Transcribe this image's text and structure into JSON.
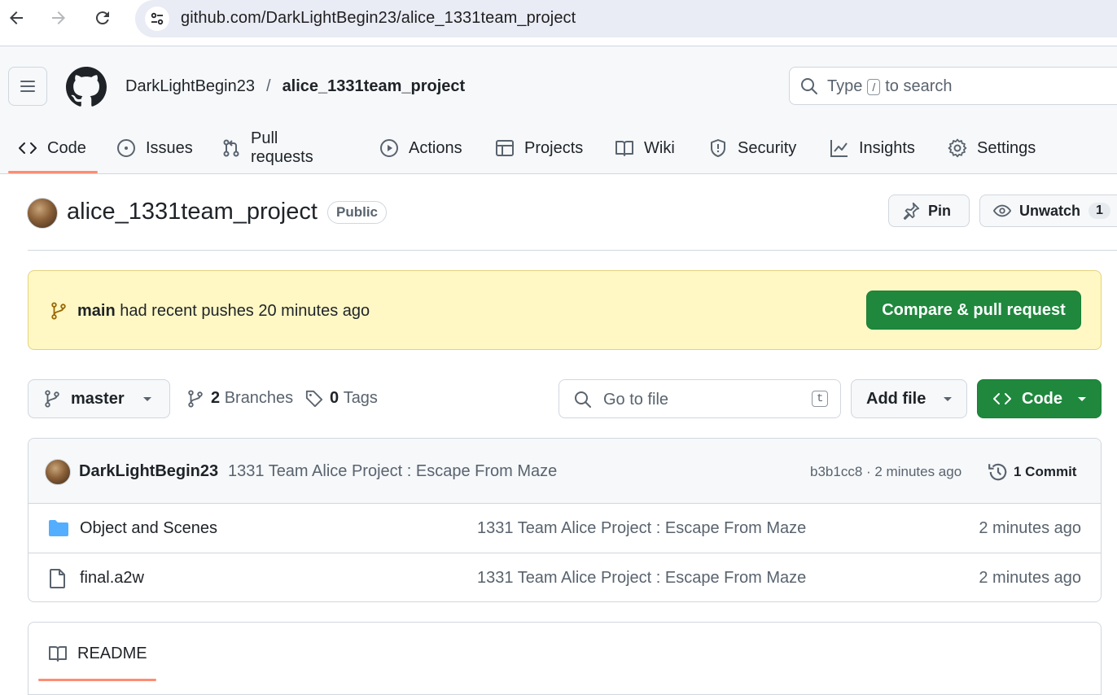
{
  "browser": {
    "url": "github.com/DarkLightBegin23/alice_1331team_project",
    "back_icon": "arrow-left-icon",
    "forward_icon": "arrow-right-icon",
    "reload_icon": "reload-icon",
    "site_info_icon": "tune-icon"
  },
  "header": {
    "owner": "DarkLightBegin23",
    "separator": "/",
    "repo": "alice_1331team_project",
    "search_prefix": "Type",
    "search_key": "/",
    "search_suffix": "to search"
  },
  "tabs": [
    {
      "label": "Code",
      "icon": "code-icon",
      "active": true
    },
    {
      "label": "Issues",
      "icon": "issue-icon"
    },
    {
      "label": "Pull requests",
      "icon": "pull-request-icon"
    },
    {
      "label": "Actions",
      "icon": "play-icon"
    },
    {
      "label": "Projects",
      "icon": "table-icon"
    },
    {
      "label": "Wiki",
      "icon": "book-icon"
    },
    {
      "label": "Security",
      "icon": "shield-icon"
    },
    {
      "label": "Insights",
      "icon": "graph-icon"
    },
    {
      "label": "Settings",
      "icon": "gear-icon"
    }
  ],
  "repo_title": {
    "name": "alice_1331team_project",
    "visibility": "Public",
    "pin_label": "Pin",
    "watch_label": "Unwatch",
    "watch_count": "1"
  },
  "flash": {
    "branch": "main",
    "message": "had recent pushes 20 minutes ago",
    "button": "Compare & pull request"
  },
  "filenav": {
    "branch": "master",
    "branches_count": "2",
    "branches_label": "Branches",
    "tags_count": "0",
    "tags_label": "Tags",
    "goto_placeholder": "Go to file",
    "goto_key": "t",
    "add_file": "Add file",
    "code_button": "Code"
  },
  "latest_commit": {
    "author": "DarkLightBegin23",
    "message": "1331 Team Alice Project : Escape From Maze",
    "hash_time": "b3b1cc8 · 2 minutes ago",
    "commits": "1 Commit"
  },
  "files": [
    {
      "name": "Object and Scenes",
      "type": "folder",
      "message": "1331 Team Alice Project : Escape From Maze",
      "date": "2 minutes ago"
    },
    {
      "name": "final.a2w",
      "type": "file",
      "message": "1331 Team Alice Project : Escape From Maze",
      "date": "2 minutes ago"
    }
  ],
  "readme": {
    "label": "README"
  },
  "colors": {
    "primary_green": "#1f883d",
    "flash_bg": "#fff8c5",
    "tab_underline": "#fd8c73",
    "folder": "#54aeff"
  }
}
